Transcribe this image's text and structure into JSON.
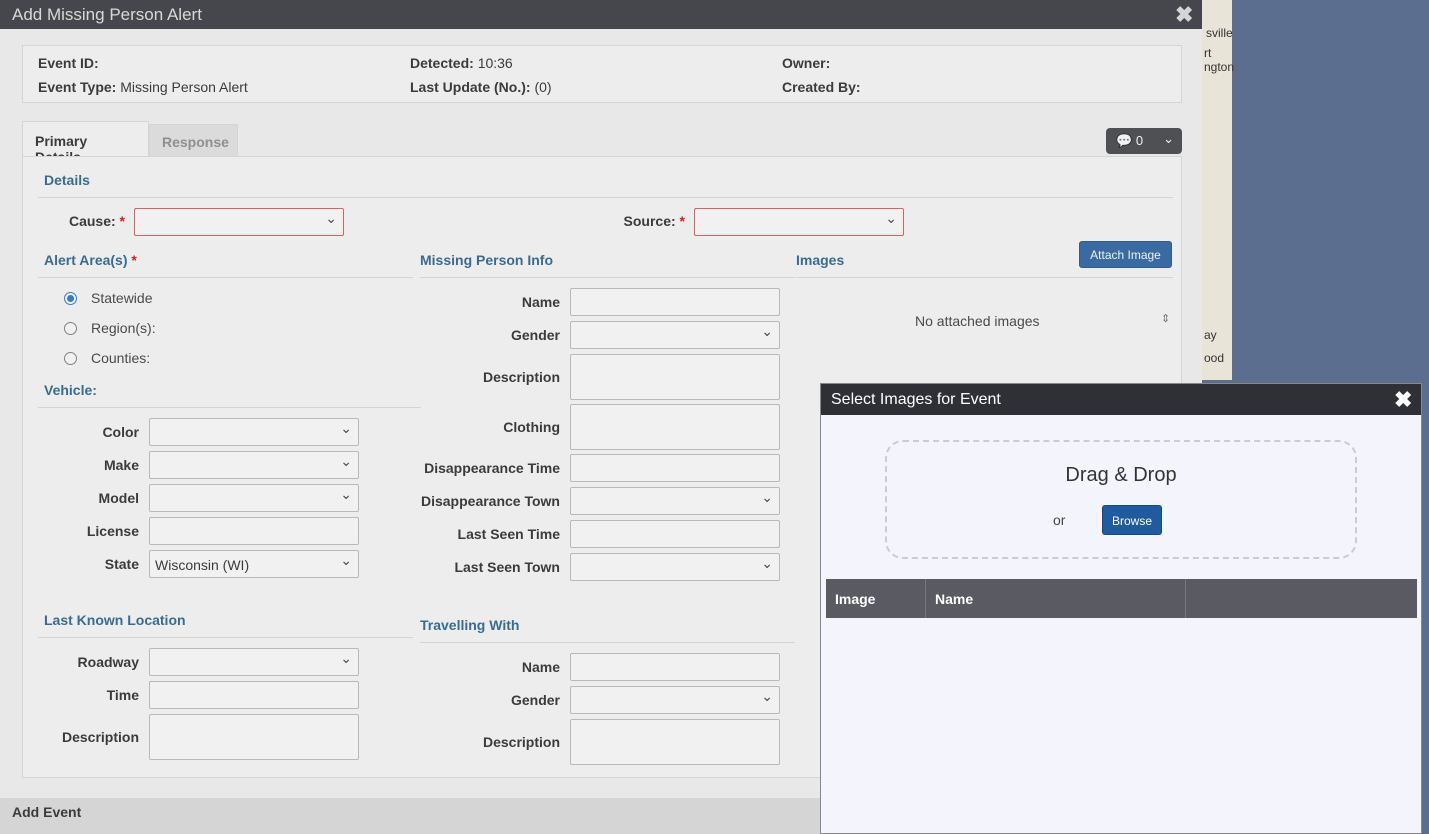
{
  "window": {
    "title": "Add Missing Person Alert"
  },
  "map": {
    "labels": [
      "sville",
      "rt",
      "ngton",
      "ay",
      "ood"
    ]
  },
  "info": {
    "event_id_label": "Event ID:",
    "event_id": "",
    "event_type_label": "Event Type:",
    "event_type": "Missing Person Alert",
    "detected_label": "Detected:",
    "detected": "10:36",
    "last_update_label": "Last Update (No.):",
    "last_update": "(0)",
    "owner_label": "Owner:",
    "created_by_label": "Created By:"
  },
  "tabs": [
    {
      "label": "Primary Details"
    },
    {
      "label": "Response"
    }
  ],
  "comments": {
    "count": "0"
  },
  "details": {
    "heading": "Details",
    "cause_label": "Cause:",
    "source_label": "Source:",
    "required": "*"
  },
  "alert_area": {
    "heading": "Alert Area(s)",
    "options": [
      {
        "label": "Statewide",
        "selected": true
      },
      {
        "label": "Region(s):",
        "selected": false
      },
      {
        "label": "Counties:",
        "selected": false
      }
    ]
  },
  "vehicle": {
    "heading": "Vehicle:",
    "fields": [
      "Color",
      "Make",
      "Model",
      "License",
      "State"
    ],
    "state_value": "Wisconsin (WI)"
  },
  "missing_person": {
    "heading": "Missing Person Info",
    "fields": [
      "Name",
      "Gender",
      "Description",
      "Clothing",
      "Disappearance Time",
      "Disappearance Town",
      "Last Seen Time",
      "Last Seen Town"
    ]
  },
  "images": {
    "heading": "Images",
    "attach_label": "Attach Image",
    "empty_text": "No attached images"
  },
  "last_known": {
    "heading": "Last Known Location",
    "fields": [
      "Roadway",
      "Time",
      "Description"
    ]
  },
  "travelling": {
    "heading": "Travelling With",
    "fields": [
      "Name",
      "Gender",
      "Description"
    ]
  },
  "footer": {
    "label": "Add Event"
  },
  "select_modal": {
    "title": "Select Images for Event",
    "drop_text": "Drag & Drop",
    "or_text": "or",
    "browse_label": "Browse",
    "columns": [
      "Image",
      "Name",
      ""
    ]
  }
}
